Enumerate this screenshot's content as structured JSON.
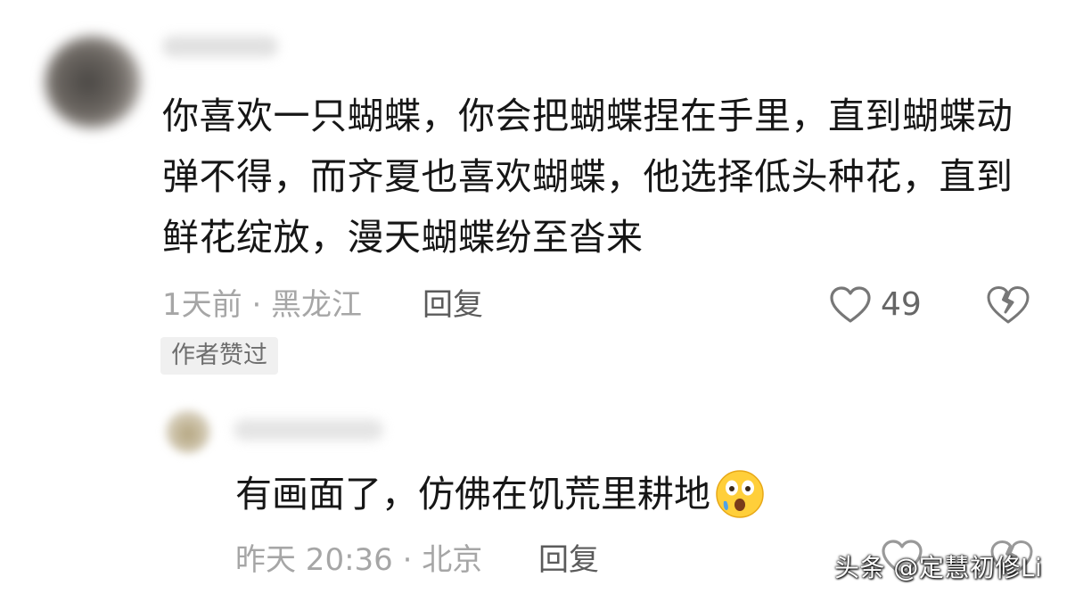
{
  "main_comment": {
    "text": "你喜欢一只蝴蝶，你会把蝴蝶捏在手里，直到蝴蝶动弹不得，而齐夏也喜欢蝴蝶，他选择低头种花，直到鲜花绽放，漫天蝴蝶纷至沓来",
    "meta": "1天前 · 黑龙江",
    "reply_label": "回复",
    "like_count": "49",
    "badge": "作者赞过",
    "icons": {
      "like": "heart-outline-icon",
      "dislike": "broken-heart-icon"
    }
  },
  "reply_comment": {
    "text": "有画面了，仿佛在饥荒里耕地",
    "emoji": "astonished-face-emoji",
    "meta": "昨天 20:36 · 北京",
    "reply_label": "回复",
    "icons": {
      "like": "heart-outline-icon",
      "dislike": "broken-heart-icon"
    }
  },
  "watermark": "头条 @定慧初修Li",
  "colors": {
    "text_primary": "#161616",
    "text_meta": "#a6a6a6",
    "text_action": "#5b5b5b",
    "icon_gray": "#777777",
    "badge_bg": "#f0f0f0",
    "emoji_yellow": "#ffcf3a"
  }
}
